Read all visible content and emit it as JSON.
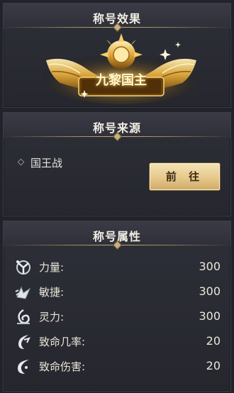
{
  "effect_panel": {
    "header": "称号效果",
    "title_badge_text": "九黎国主",
    "badge_gold": "#f2c25a"
  },
  "source_panel": {
    "header": "称号来源",
    "source_label": "国王战",
    "go_button": "前 往"
  },
  "attributes_panel": {
    "header": "称号属性",
    "items": [
      {
        "name": "力量:",
        "value": "300",
        "icon": "power-icon"
      },
      {
        "name": "敏捷:",
        "value": "300",
        "icon": "agility-icon"
      },
      {
        "name": "灵力:",
        "value": "300",
        "icon": "spirit-icon"
      },
      {
        "name": "致命几率:",
        "value": "20",
        "icon": "crit-rate-icon"
      },
      {
        "name": "致命伤害:",
        "value": "20",
        "icon": "crit-damage-icon"
      }
    ]
  }
}
